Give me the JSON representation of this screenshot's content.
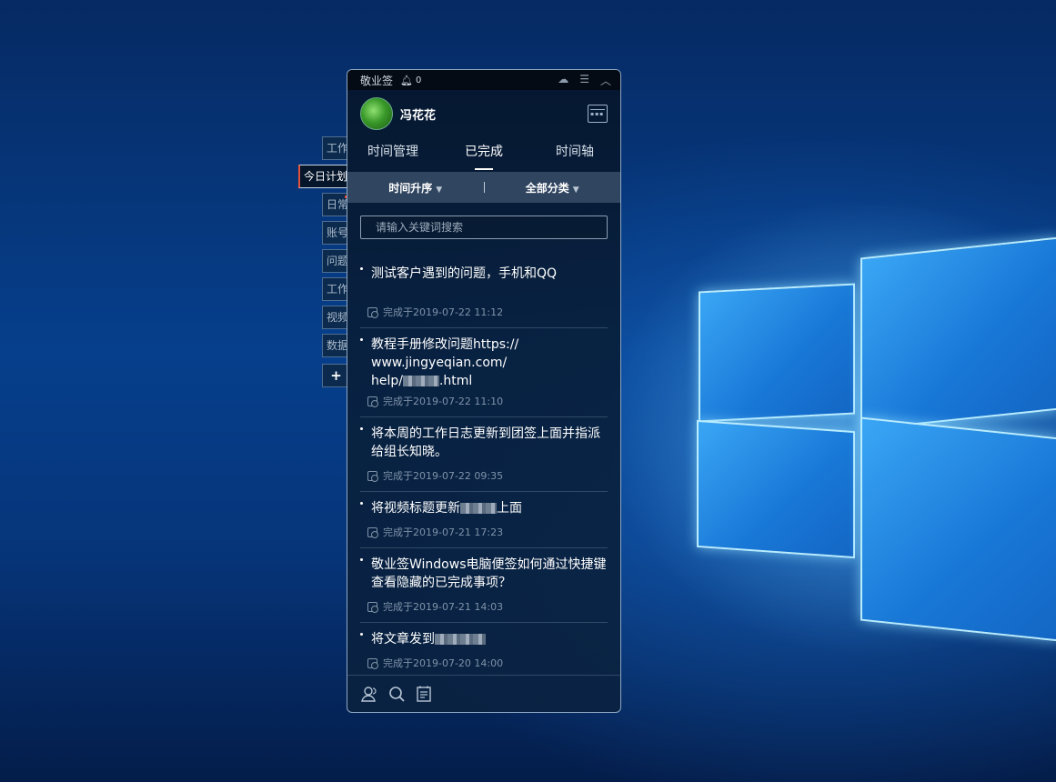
{
  "window": {
    "app_title": "敬业签",
    "reminder_count": "0"
  },
  "user": {
    "name": "冯花花"
  },
  "tabs": [
    {
      "label": "时间管理",
      "active": false
    },
    {
      "label": "已完成",
      "active": true
    },
    {
      "label": "时间轴",
      "active": false
    }
  ],
  "filters": {
    "sort_label": "时间升序",
    "category_label": "全部分类"
  },
  "search": {
    "placeholder": "请输入关键词搜索"
  },
  "side_tags": [
    {
      "label": "工作",
      "active": false
    },
    {
      "label": "今日计划",
      "active": true
    },
    {
      "label": "日常",
      "active": false
    },
    {
      "label": "账号",
      "active": false
    },
    {
      "label": "问题",
      "active": false
    },
    {
      "label": "工作",
      "active": false
    },
    {
      "label": "视频",
      "active": false
    },
    {
      "label": "数据",
      "active": false
    },
    {
      "label": "+",
      "active": false
    }
  ],
  "items": [
    {
      "title": "测试客户遇到的问题，手机和QQ",
      "completed": "完成于2019-07-22 11:12"
    },
    {
      "title_part1": "教程手册修改问题https://",
      "title_part2": "www.jingyeqian.com/",
      "title_part3a": "help/",
      "title_part3b": ".html",
      "completed": "完成于2019-07-22 11:10"
    },
    {
      "title": "将本周的工作日志更新到团签上面并指派给组长知晓。",
      "completed": "完成于2019-07-22 09:35"
    },
    {
      "title_a": "将视频标题更新",
      "title_b": "上面",
      "completed": "完成于2019-07-21 17:23"
    },
    {
      "title": "敬业签Windows电脑便签如何通过快捷键查看隐藏的已完成事项？",
      "completed": "完成于2019-07-21 14:03"
    },
    {
      "title_a": "将文章发到",
      "completed": "完成于2019-07-20 14:00"
    }
  ],
  "icons": {
    "bell": "bell-icon",
    "cloud": "cloud-sync-icon",
    "menu": "menu-icon",
    "collapse": "chevron-up-icon",
    "calendar": "calendar-icon",
    "clock": "clock-icon",
    "team": "team-icon",
    "search": "search-icon",
    "notes": "notes-icon"
  },
  "colors": {
    "accent_red": "#e0503a",
    "panel_bg": "#0a2240"
  }
}
